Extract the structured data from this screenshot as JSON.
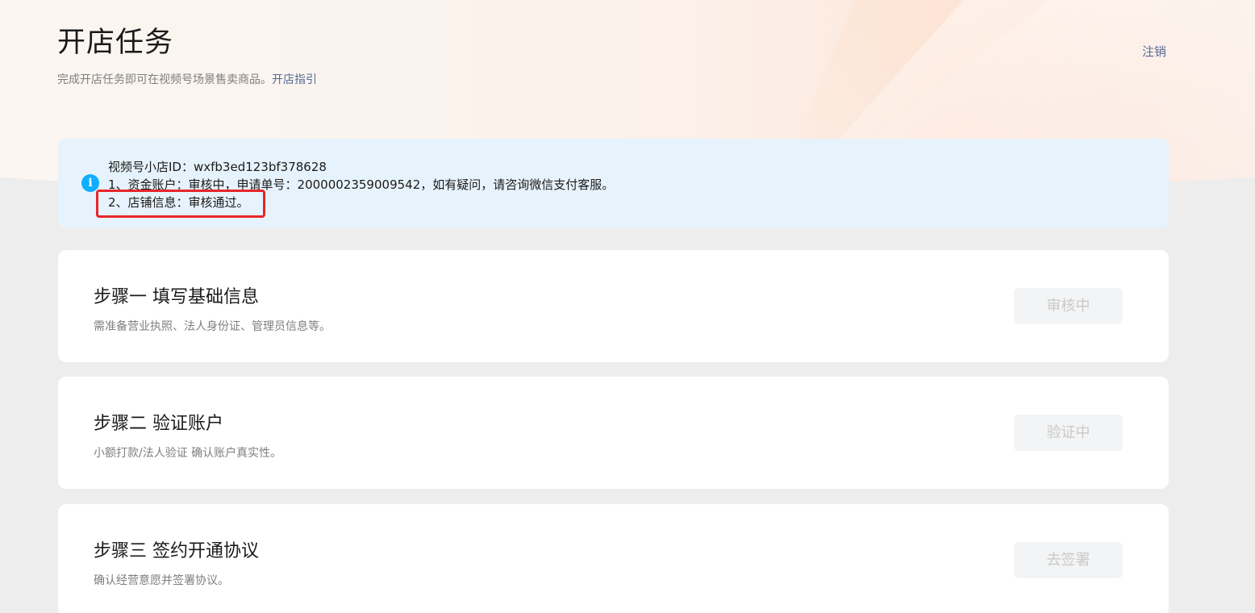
{
  "header": {
    "title": "开店任务",
    "subtitle": "完成开店任务即可在视频号场景售卖商品。",
    "guide_link": "开店指引",
    "logout": "注销"
  },
  "notice": {
    "icon": "info-icon",
    "line1": "视频号小店ID：wxfb3ed123bf378628",
    "line2": "1、资金账户：审核中，申请单号：2000002359009542，如有疑问，请咨询微信支付客服。",
    "line3": "2、店铺信息：审核通过。",
    "highlight_color": "#e6262a",
    "icon_color": "#10aeff"
  },
  "steps": [
    {
      "title": "步骤一 填写基础信息",
      "desc": "需准备营业执照、法人身份证、管理员信息等。",
      "button": "审核中"
    },
    {
      "title": "步骤二 验证账户",
      "desc": "小额打款/法人验证 确认账户真实性。",
      "button": "验证中"
    },
    {
      "title": "步骤三 签约开通协议",
      "desc": "确认经营意愿并签署协议。",
      "button": "去签署"
    }
  ]
}
